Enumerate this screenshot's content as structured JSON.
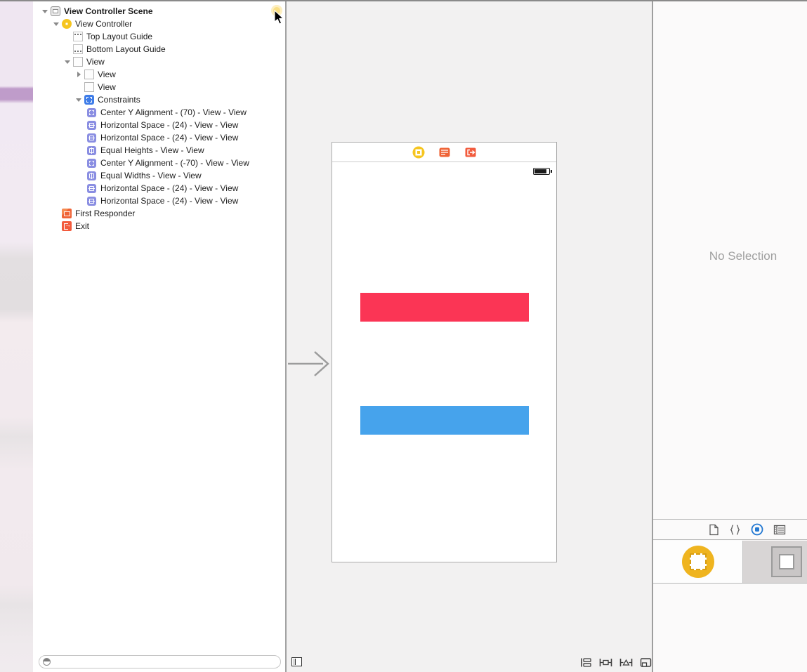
{
  "outline": {
    "items": [
      {
        "label": "View Controller Scene",
        "icon": "scene-icon"
      },
      {
        "label": "View Controller",
        "icon": "view-controller-icon"
      },
      {
        "label": "Top Layout Guide",
        "icon": "top-layout-guide-icon"
      },
      {
        "label": "Bottom Layout Guide",
        "icon": "bottom-layout-guide-icon"
      },
      {
        "label": "View",
        "icon": "view-icon"
      },
      {
        "label": "View",
        "icon": "view-icon"
      },
      {
        "label": "View",
        "icon": "view-icon"
      },
      {
        "label": "Constraints",
        "icon": "constraints-icon"
      },
      {
        "label": "Center Y Alignment - (70) - View - View",
        "icon": "center-y-constraint-icon"
      },
      {
        "label": "Horizontal Space - (24) - View - View",
        "icon": "horizontal-space-constraint-icon"
      },
      {
        "label": "Horizontal Space - (24) - View - View",
        "icon": "horizontal-space-constraint-icon"
      },
      {
        "label": "Equal Heights - View - View",
        "icon": "equal-heights-constraint-icon"
      },
      {
        "label": "Center Y Alignment - (-70) - View - View",
        "icon": "center-y-constraint-icon"
      },
      {
        "label": "Equal Widths - View - View",
        "icon": "equal-widths-constraint-icon"
      },
      {
        "label": "Horizontal Space - (24) - View - View",
        "icon": "horizontal-space-constraint-icon"
      },
      {
        "label": "Horizontal Space - (24) - View - View",
        "icon": "horizontal-space-constraint-icon"
      },
      {
        "label": "First Responder",
        "icon": "first-responder-icon"
      },
      {
        "label": "Exit",
        "icon": "exit-icon"
      }
    ],
    "filter_value": ""
  },
  "canvas": {
    "scene_dock_icons": [
      "view-controller-icon",
      "first-responder-icon",
      "exit-icon"
    ],
    "layout_buttons": [
      "stack-button",
      "align-button",
      "pin-button",
      "resolve-auto-layout-button"
    ]
  },
  "inspector": {
    "empty_text": "No Selection"
  },
  "library": {
    "toolbar_icons": [
      "file-template-library-icon",
      "code-snippet-library-icon",
      "object-library-icon",
      "media-library-icon"
    ],
    "selected_toolbar_icon": "object-library-icon",
    "items": [
      {
        "name": "view-controller-item",
        "selected": false
      },
      {
        "name": "view-item",
        "selected": true
      }
    ]
  },
  "colors": {
    "red_bar": "#fb3555",
    "blue_bar": "#46a3ec",
    "accent_yellow": "#f6c51f",
    "selected_blue": "#2479d2"
  }
}
